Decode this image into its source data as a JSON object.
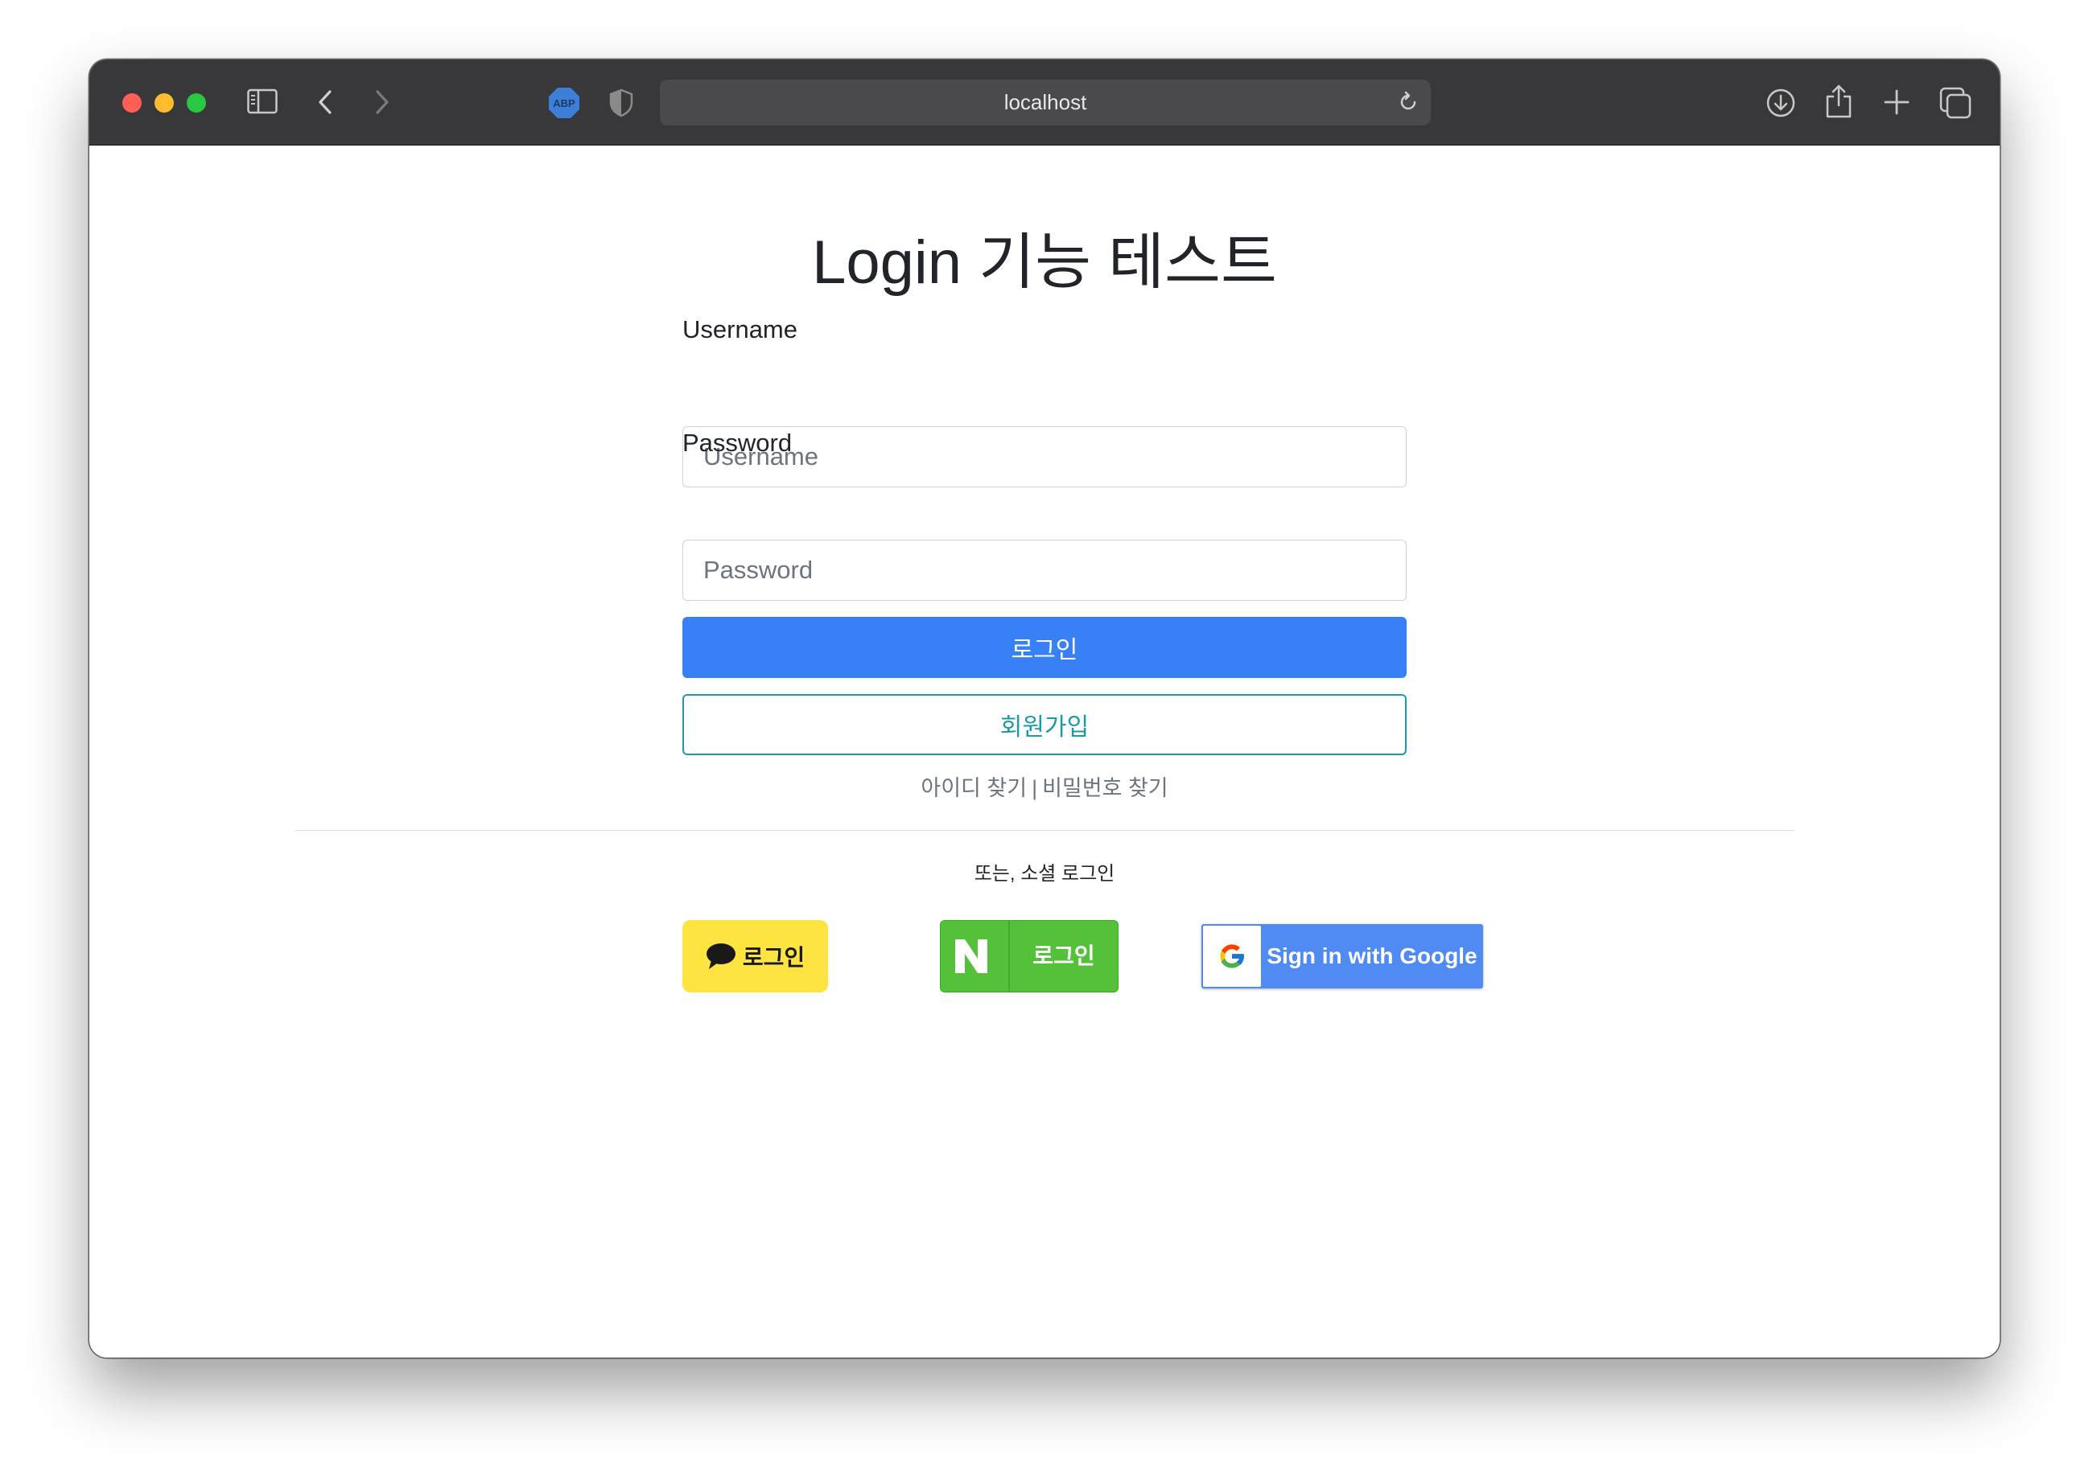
{
  "browser": {
    "address": "localhost",
    "icons": {
      "sidebar": "sidebar-icon",
      "back": "chevron-left-icon",
      "forward": "chevron-right-icon",
      "adblock": "abp-icon",
      "privacy": "shield-icon",
      "reload": "reload-icon",
      "download": "download-icon",
      "share": "share-icon",
      "new_tab": "plus-icon",
      "tabs": "tabs-overview-icon"
    },
    "abp_text": "ABP"
  },
  "page": {
    "title": "Login 기능 테스트",
    "username_label": "Username",
    "username_placeholder": "Username",
    "password_label": "Password",
    "password_placeholder": "Password",
    "login_button": "로그인",
    "signup_button": "회원가입",
    "find_id": "아이디 찾기",
    "separator": "|",
    "find_password": "비밀번호 찾기",
    "social_caption": "또는, 소셜 로그인"
  },
  "social": {
    "kakao_label": "로그인",
    "naver_label": "로그인",
    "google_label": "Sign in with Google"
  },
  "colors": {
    "primary": "#3880f6",
    "outline": "#1e9aa6",
    "kakao": "#fee441",
    "naver": "#55c13a",
    "google": "#4f8bf3"
  }
}
